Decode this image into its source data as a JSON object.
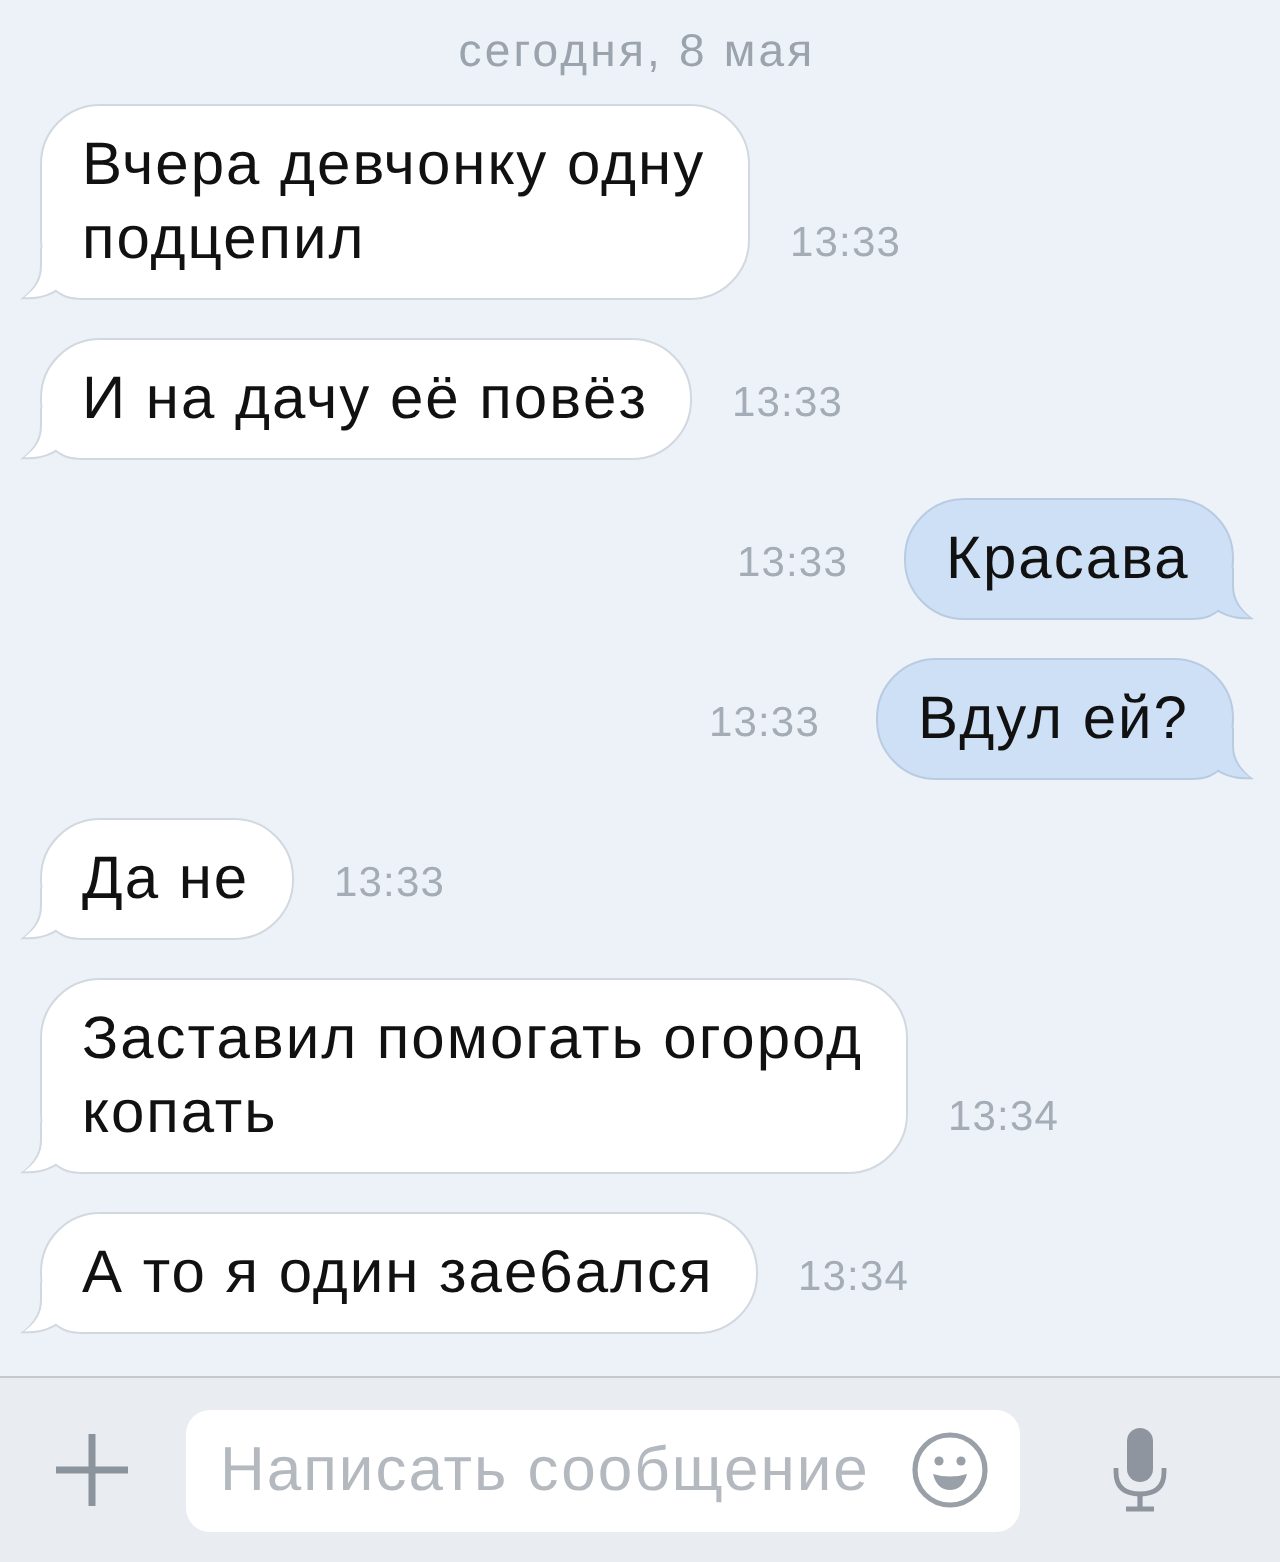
{
  "date_header": "сегодня, 8 мая",
  "messages": [
    {
      "kind": "incoming",
      "text": "Вчера девчонку одну подцепил",
      "time": "13:33"
    },
    {
      "kind": "incoming",
      "text": "И на дачу её повёз",
      "time": "13:33"
    },
    {
      "kind": "outgoing",
      "text": "Красава",
      "time": "13:33"
    },
    {
      "kind": "outgoing",
      "text": "Вдул ей?",
      "time": "13:33"
    },
    {
      "kind": "incoming",
      "text": "Да не",
      "time": "13:33"
    },
    {
      "kind": "incoming",
      "text": "Заставил помогать огород копать",
      "time": "13:34"
    },
    {
      "kind": "incoming",
      "text": "А то я один зае6ался",
      "time": "13:34"
    }
  ],
  "composer": {
    "placeholder": "Написать сообщение"
  }
}
